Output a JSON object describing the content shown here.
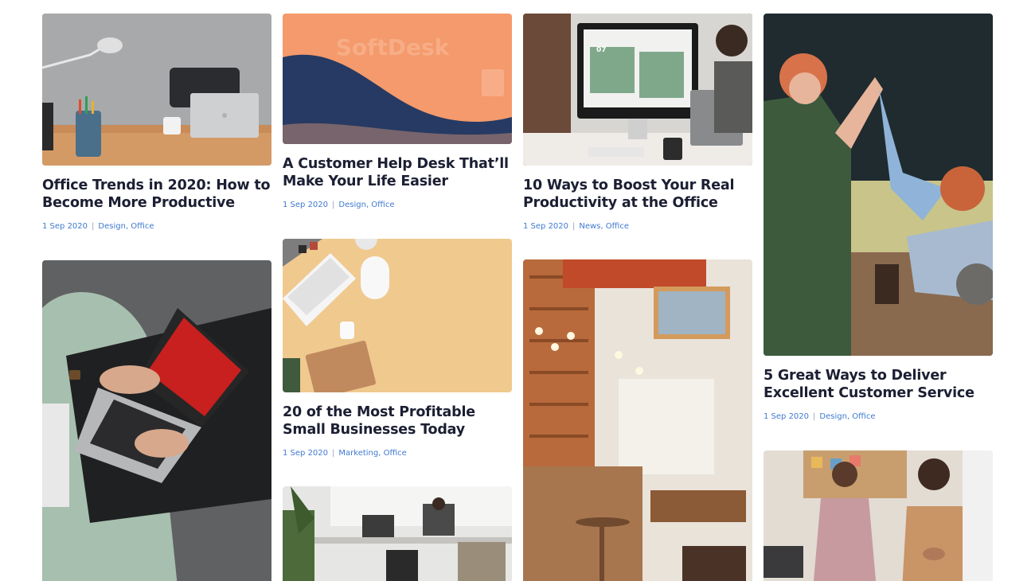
{
  "posts": [
    {
      "title": "Office Trends in 2020: How to Become More Productive",
      "date": "1 Sep 2020",
      "tags": [
        "Design",
        "Office"
      ]
    },
    {
      "title": "A Customer Help Desk That’ll Make Your Life Easier",
      "date": "1 Sep 2020",
      "tags": [
        "Design",
        "Office"
      ],
      "image_text": "SoftDesk"
    },
    {
      "title": "10 Ways to Boost Your Real Productivity at the Office",
      "date": "1 Sep 2020",
      "tags": [
        "News",
        "Office"
      ],
      "image_text": "07"
    },
    {
      "title": "5 Great Ways to Deliver Excellent Customer Service",
      "date": "1 Sep 2020",
      "tags": [
        "Design",
        "Office"
      ]
    },
    {
      "title": "20 of the Most Profitable Small Businesses Today",
      "date": "1 Sep 2020",
      "tags": [
        "Marketing",
        "Office"
      ]
    },
    {
      "title": "",
      "date": "",
      "tags": []
    },
    {
      "title": "",
      "date": "",
      "tags": []
    },
    {
      "title": "",
      "date": "",
      "tags": []
    },
    {
      "title": "",
      "date": "",
      "tags": []
    }
  ],
  "colors": {
    "title": "#1c1f33",
    "meta_link": "#3f7ad0",
    "separator": "#9aa3b5"
  }
}
